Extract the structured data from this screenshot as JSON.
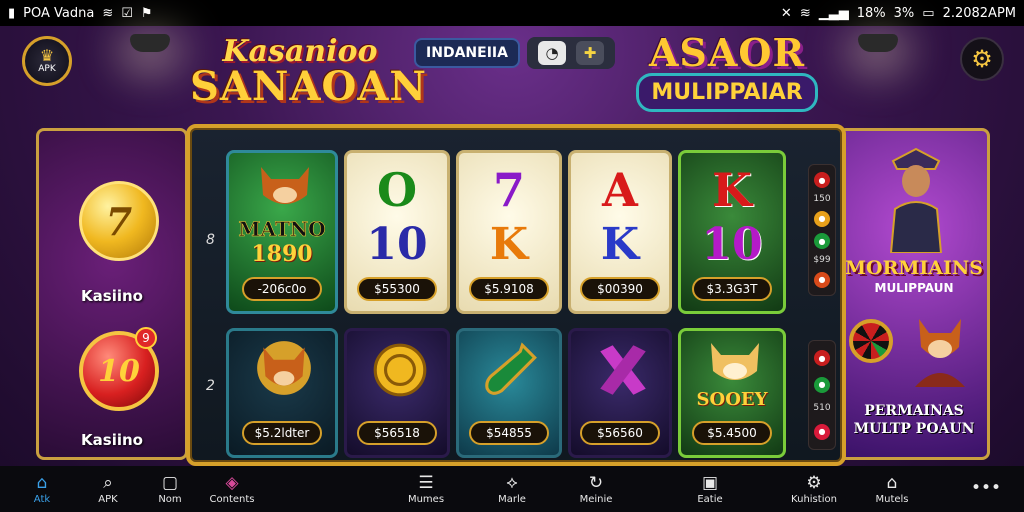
{
  "status_bar": {
    "left_text": "POA Vadna",
    "battery": "3%",
    "time": "2.2082APM",
    "signal_text": "18%"
  },
  "header": {
    "apk_badge_label": "APK",
    "logo_left_line1": "Kasanioo",
    "logo_left_line2": "SANAOAN",
    "language_pill": "INDANEIIA",
    "logo_right_line1": "ASAOR",
    "logo_right_line2": "MULIPPAIAR"
  },
  "left_panel": {
    "coin_top_value": "7",
    "coin_top_label": "Kasiino",
    "coin_bottom_value": "10",
    "coin_bottom_badge": "9",
    "coin_bottom_label": "Kasiino"
  },
  "right_panel": {
    "title": "MORMIAINS",
    "subtitle": "MULIPPAUN",
    "bottom_line1": "PERMAINAS",
    "bottom_line2": "MULTP POAUN"
  },
  "board": {
    "row_marks": [
      "8",
      "2"
    ],
    "row1": [
      {
        "symbol_text": "MATNO",
        "sub_text": "1890",
        "price": "-206c0o"
      },
      {
        "symbol_text": "O",
        "sub_text": "10",
        "price": "$55300"
      },
      {
        "symbol_text": "7",
        "sub_text": "K",
        "price": "$5.9108"
      },
      {
        "symbol_text": "A",
        "sub_text": "K",
        "price": "$00390"
      },
      {
        "symbol_text": "K",
        "sub_text": "10",
        "price": "$3.3G3T"
      }
    ],
    "row2": [
      {
        "symbol_text": "",
        "sub_text": "",
        "price": "$5.2ldter"
      },
      {
        "symbol_text": "",
        "sub_text": "",
        "price": "$56518"
      },
      {
        "symbol_text": "",
        "sub_text": "",
        "price": "$54855"
      },
      {
        "symbol_text": "",
        "sub_text": "",
        "price": "$56560"
      },
      {
        "symbol_text": "",
        "sub_text": "SOOEY",
        "price": "$5.4500"
      }
    ],
    "stack_top_nums": [
      "150",
      "$99"
    ],
    "stack_bottom_nums": [
      "510"
    ]
  },
  "bottom_nav": [
    {
      "label": "Atk",
      "icon": "home-icon",
      "active": true
    },
    {
      "label": "APK",
      "icon": "search-icon"
    },
    {
      "label": "Nom",
      "icon": "chat-icon"
    },
    {
      "label": "Contents",
      "icon": "grid-icon"
    },
    {
      "label": "Mumes",
      "icon": "menu-icon"
    },
    {
      "label": "Marle",
      "icon": "link-icon"
    },
    {
      "label": "Meinie",
      "icon": "refresh-icon"
    },
    {
      "label": "Eatie",
      "icon": "card-icon"
    },
    {
      "label": "Kuhistion",
      "icon": "gear-icon"
    },
    {
      "label": "Mutels",
      "icon": "house-icon"
    },
    {
      "label": "",
      "icon": "more-icon"
    }
  ],
  "colors": {
    "gold": "#d6a02a",
    "accent_blue": "#3aa0e8",
    "bg_purple": "#3a1650"
  }
}
